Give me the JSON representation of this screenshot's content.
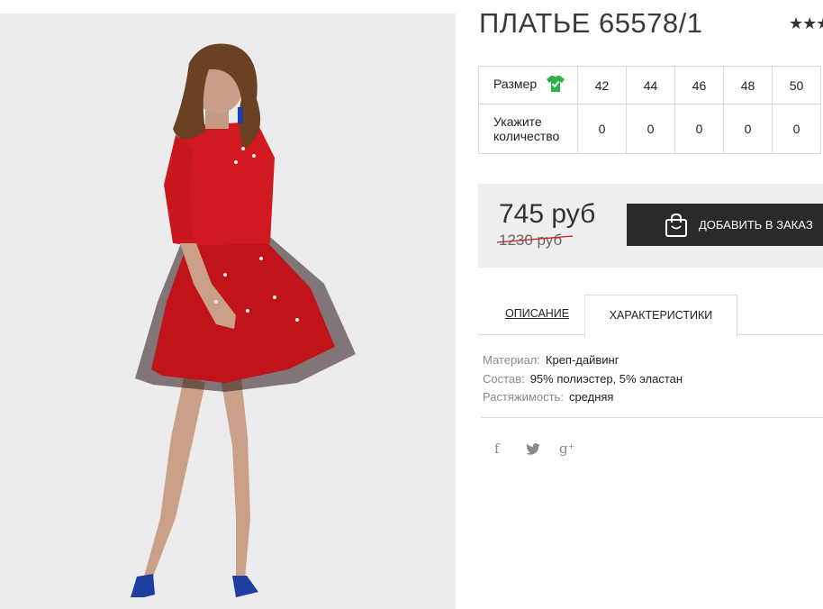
{
  "product": {
    "title": "ПЛАТЬЕ 65578/1",
    "rating_display": "★★★★★"
  },
  "sizes_table": {
    "size_label": "Размер",
    "size_icon": "tshirt-check-icon",
    "sizes": [
      "42",
      "44",
      "46",
      "48",
      "50"
    ],
    "qty_label": "Укажите количество",
    "quantities": [
      "0",
      "0",
      "0",
      "0",
      "0"
    ]
  },
  "price": {
    "current": "745 руб",
    "old": "1230 руб"
  },
  "add_button": {
    "label": "ДОБАВИТЬ В ЗАКАЗ",
    "icon": "shopping-bag-icon"
  },
  "tabs": {
    "description": "ОПИСАНИЕ",
    "characteristics": "ХАРАКТЕРИСТИКИ",
    "active": "characteristics"
  },
  "specs": [
    {
      "key": "Материал:",
      "value": "Креп-дайвинг"
    },
    {
      "key": "Состав:",
      "value": "95% полиэстер, 5% эластан"
    },
    {
      "key": "Растяжимость:",
      "value": "средняя"
    }
  ],
  "social": {
    "facebook": "f",
    "twitter": "twitter-icon",
    "google_plus": "g⁺"
  },
  "colors": {
    "dress": "#d01a1f",
    "button_bg": "#2a2a2a",
    "price_box_bg": "#efefef",
    "size_icon": "#2bb34a",
    "photo_bg": "#ececee"
  }
}
